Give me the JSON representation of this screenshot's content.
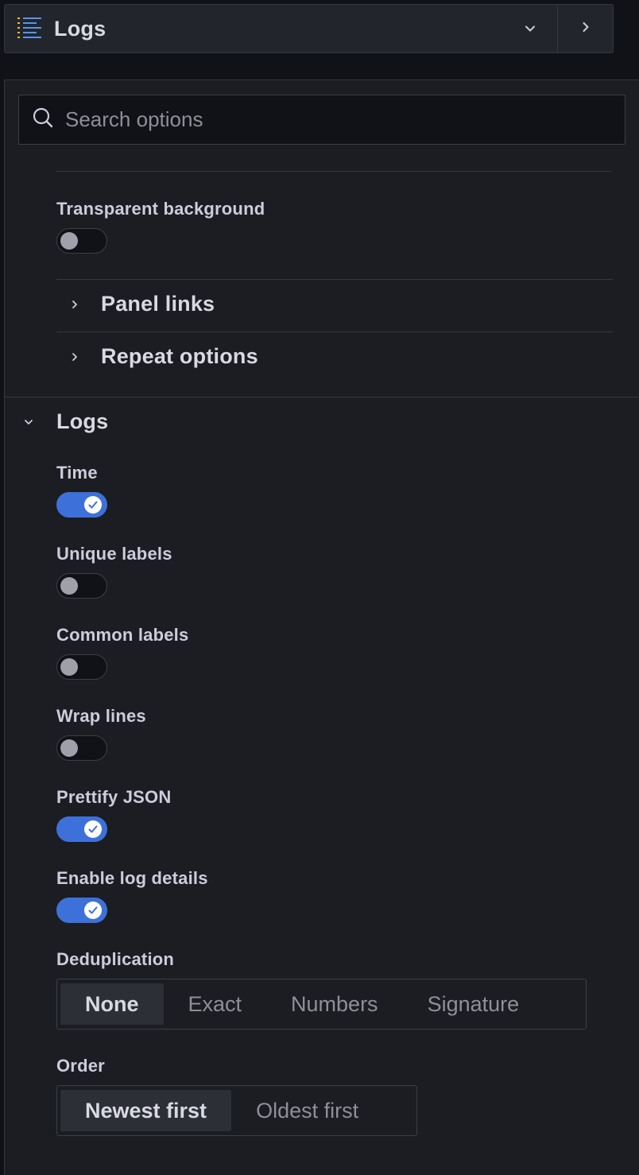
{
  "visualization": {
    "title": "Logs",
    "icon": "logs-list-icon",
    "caret_icon": "chevron-down-icon",
    "expand_icon": "chevron-right-icon"
  },
  "search": {
    "placeholder": "Search options",
    "value": "",
    "icon": "search-icon"
  },
  "panel_options": {
    "transparent_background": {
      "label": "Transparent background",
      "enabled": false
    },
    "sections": [
      {
        "label": "Panel links",
        "expanded": false
      },
      {
        "label": "Repeat options",
        "expanded": false
      }
    ]
  },
  "logs_section": {
    "title": "Logs",
    "expanded": true,
    "switches": [
      {
        "label": "Time",
        "enabled": true
      },
      {
        "label": "Unique labels",
        "enabled": false
      },
      {
        "label": "Common labels",
        "enabled": false
      },
      {
        "label": "Wrap lines",
        "enabled": false
      },
      {
        "label": "Prettify JSON",
        "enabled": true
      },
      {
        "label": "Enable log details",
        "enabled": true
      }
    ],
    "deduplication": {
      "label": "Deduplication",
      "options": [
        "None",
        "Exact",
        "Numbers",
        "Signature"
      ],
      "selected": "None"
    },
    "order": {
      "label": "Order",
      "options": [
        "Newest first",
        "Oldest first"
      ],
      "selected": "Newest first"
    }
  },
  "colors": {
    "accent": "#3d71d9",
    "background": "#111217",
    "panel": "#1b1d22",
    "border": "#34373e"
  }
}
